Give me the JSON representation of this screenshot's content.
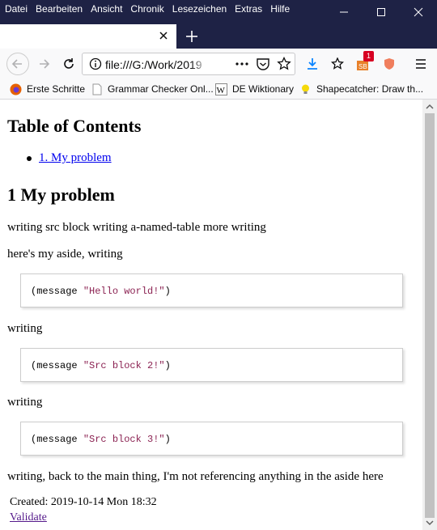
{
  "menu": [
    "Datei",
    "Bearbeiten",
    "Ansicht",
    "Chronik",
    "Lesezeichen",
    "Extras",
    "Hilfe"
  ],
  "url": "file:///G:/Work/2019",
  "bookmarks": [
    "Erste Schritte",
    "Grammar Checker Onl...",
    "DE Wiktionary",
    "Shapecatcher: Draw th..."
  ],
  "badge": "1",
  "page": {
    "toc_title": "Table of Contents",
    "toc_item": "1. My problem",
    "section_title": "1 My problem",
    "p1": "writing src block writing a-named-table more writing",
    "p2": "here's my aside, writing",
    "src1_fn": "(message ",
    "src1_str": "\"Hello world!\"",
    "src_close": ")",
    "writing": "writing",
    "src2_str": "\"Src block 2!\"",
    "src3_str": "\"Src block 3!\"",
    "p_final": "writing, back to the main thing, I'm not referencing anything in the aside here",
    "created": "Created: 2019-10-14 Mon 18:32",
    "validate": "Validate"
  }
}
